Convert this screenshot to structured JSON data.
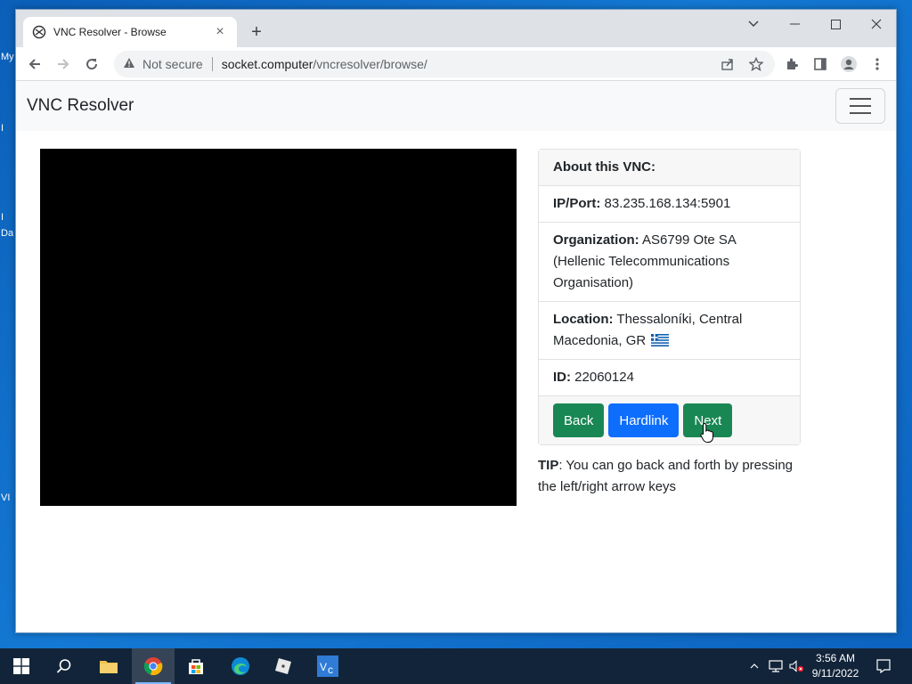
{
  "desktop": {
    "fragments": [
      "My",
      "I",
      "I",
      "Da",
      "VI"
    ]
  },
  "browser": {
    "tab_title": "VNC Resolver - Browse",
    "not_secure": "Not secure",
    "url_host": "socket.computer",
    "url_path": "/vncresolver/browse/"
  },
  "page": {
    "brand": "VNC Resolver",
    "card": {
      "header": "About this VNC:",
      "ip_label": "IP/Port:",
      "ip_value": "83.235.168.134:5901",
      "org_label": "Organization:",
      "org_value": "AS6799 Ote SA (Hellenic Telecommunications Organisation)",
      "loc_label": "Location:",
      "loc_value": "Thessaloníki, Central Macedonia, GR",
      "id_label": "ID:",
      "id_value": "22060124"
    },
    "buttons": {
      "back": "Back",
      "hardlink": "Hardlink",
      "next": "Next"
    },
    "tip_label": "TIP",
    "tip_text": ": You can go back and forth by pressing the left/right arrow keys"
  },
  "taskbar": {
    "time": "3:56 AM",
    "date": "9/11/2022"
  },
  "colors": {
    "green_button": "#198754",
    "blue_button": "#0d6efd",
    "desktop": "#0b5fb8"
  }
}
